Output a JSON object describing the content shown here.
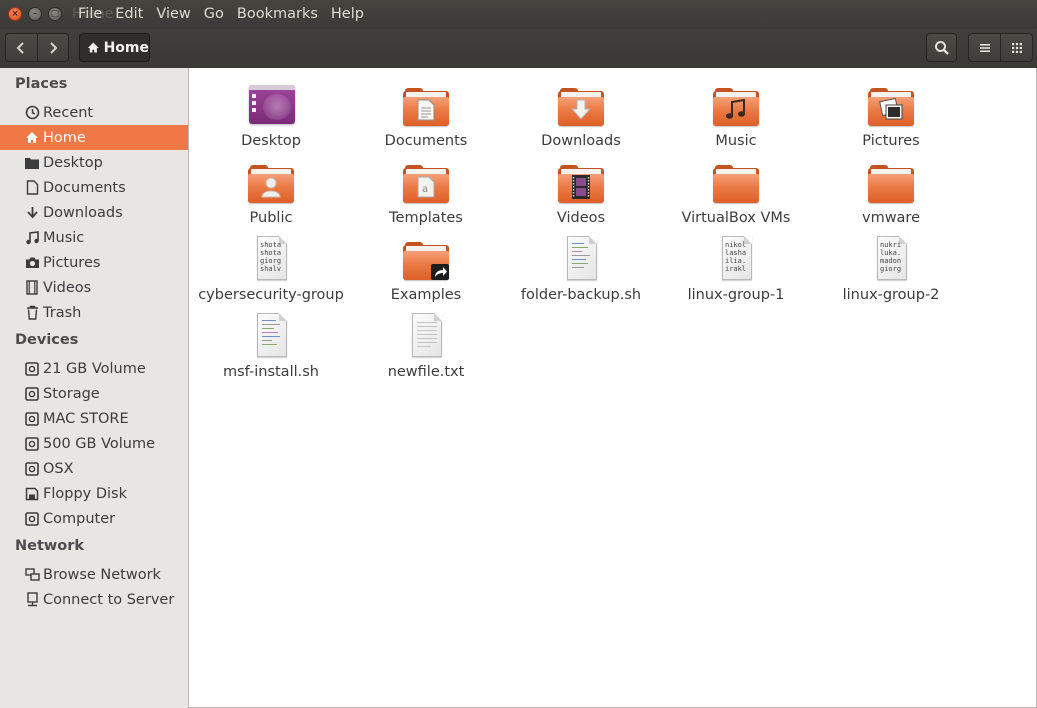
{
  "window": {
    "title": "Home",
    "close_glyph": "×",
    "min_glyph": "–",
    "max_glyph": "□"
  },
  "menu": [
    "File",
    "Edit",
    "View",
    "Go",
    "Bookmarks",
    "Help"
  ],
  "toolbar": {
    "path_label": "Home",
    "icons": [
      "back-icon",
      "forward-icon",
      "home-icon",
      "search-icon",
      "list-view-icon",
      "grid-view-icon"
    ]
  },
  "sidebar": {
    "places_header": "Places",
    "places": [
      {
        "label": "Recent",
        "icon": "clock-icon"
      },
      {
        "label": "Home",
        "icon": "home-icon",
        "active": true
      },
      {
        "label": "Desktop",
        "icon": "folder-icon"
      },
      {
        "label": "Documents",
        "icon": "document-icon"
      },
      {
        "label": "Downloads",
        "icon": "download-icon"
      },
      {
        "label": "Music",
        "icon": "music-note-icon"
      },
      {
        "label": "Pictures",
        "icon": "camera-icon"
      },
      {
        "label": "Videos",
        "icon": "film-icon"
      },
      {
        "label": "Trash",
        "icon": "trash-icon"
      }
    ],
    "devices_header": "Devices",
    "devices": [
      {
        "label": "21 GB Volume",
        "icon": "drive-icon"
      },
      {
        "label": "Storage",
        "icon": "drive-icon"
      },
      {
        "label": "MAC STORE",
        "icon": "drive-icon"
      },
      {
        "label": "500 GB Volume",
        "icon": "drive-icon"
      },
      {
        "label": "OSX",
        "icon": "drive-icon"
      },
      {
        "label": "Floppy Disk",
        "icon": "floppy-icon"
      },
      {
        "label": "Computer",
        "icon": "drive-icon"
      }
    ],
    "network_header": "Network",
    "network": [
      {
        "label": "Browse Network",
        "icon": "network-icon"
      },
      {
        "label": "Connect to Server",
        "icon": "server-icon"
      }
    ]
  },
  "files": [
    {
      "name": "Desktop",
      "kind": "desktop"
    },
    {
      "name": "Documents",
      "kind": "folder",
      "emblem": "document"
    },
    {
      "name": "Downloads",
      "kind": "folder",
      "emblem": "download"
    },
    {
      "name": "Music",
      "kind": "folder",
      "emblem": "music"
    },
    {
      "name": "Pictures",
      "kind": "folder",
      "emblem": "pictures"
    },
    {
      "name": "Public",
      "kind": "folder",
      "emblem": "person"
    },
    {
      "name": "Templates",
      "kind": "folder",
      "emblem": "template"
    },
    {
      "name": "Videos",
      "kind": "folder",
      "emblem": "film"
    },
    {
      "name": "VirtualBox VMs",
      "kind": "folder"
    },
    {
      "name": "vmware",
      "kind": "folder"
    },
    {
      "name": "cybersecurity-group",
      "kind": "text",
      "preview": "shota\nshota\ngiorg\nshalv"
    },
    {
      "name": "Examples",
      "kind": "folder",
      "emblem": "link"
    },
    {
      "name": "folder-backup.sh",
      "kind": "script"
    },
    {
      "name": "linux-group-1",
      "kind": "text",
      "preview": "nikol\nlasha\nilia.\nirakl"
    },
    {
      "name": "linux-group-2",
      "kind": "text",
      "preview": "nukri\nluka.\nmadon\ngiorg"
    },
    {
      "name": "msf-install.sh",
      "kind": "script"
    },
    {
      "name": "newfile.txt",
      "kind": "textfile"
    }
  ],
  "colors": {
    "accent": "#f07746",
    "folder": "#e67a44",
    "sidebar_bg": "#e8e6e3",
    "toolbar_bg": "#3c3b37"
  }
}
